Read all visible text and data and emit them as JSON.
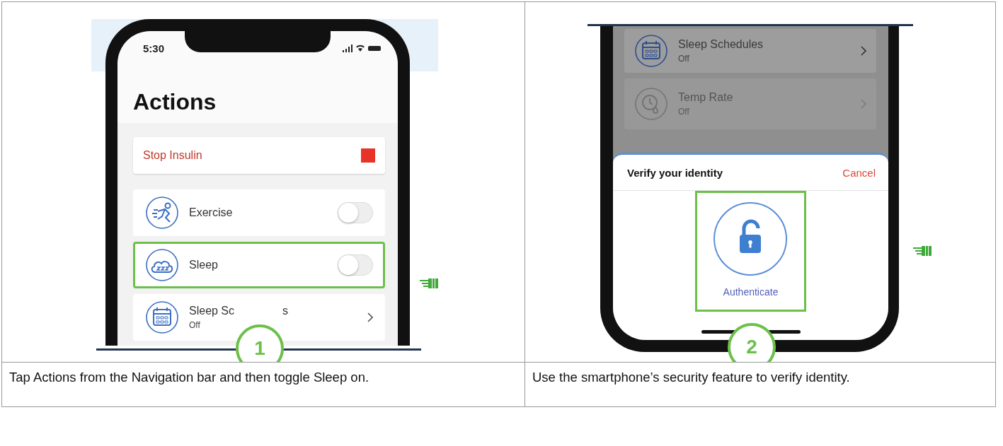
{
  "steps": [
    {
      "kind": "actions",
      "number": "1",
      "caption": "Tap Actions from the Navigation bar and then toggle Sleep on.",
      "screen": {
        "time": "5:30",
        "title": "Actions",
        "stop_button": {
          "label": "Stop Insulin"
        },
        "items": [
          {
            "kind": "toggle",
            "label": "Exercise",
            "on": false,
            "highlighted": false
          },
          {
            "kind": "toggle",
            "label": "Sleep",
            "on": false,
            "highlighted": true
          },
          {
            "kind": "link",
            "label": "Sleep Sc",
            "label_tail": "s",
            "subtitle": "Off",
            "highlighted": false
          }
        ]
      }
    },
    {
      "kind": "verify",
      "number": "2",
      "caption": "Use the smartphone’s security feature to verify identity.",
      "screen": {
        "items": [
          {
            "kind": "link",
            "label": "Sleep Schedules",
            "subtitle": "Off",
            "disabled": false
          },
          {
            "kind": "link",
            "label": "Temp Rate",
            "subtitle": "Off",
            "disabled": true
          }
        ],
        "sheet": {
          "title": "Verify your identity",
          "cancel": "Cancel",
          "action": {
            "label": "Authenticate",
            "highlighted": true
          }
        }
      }
    }
  ]
}
